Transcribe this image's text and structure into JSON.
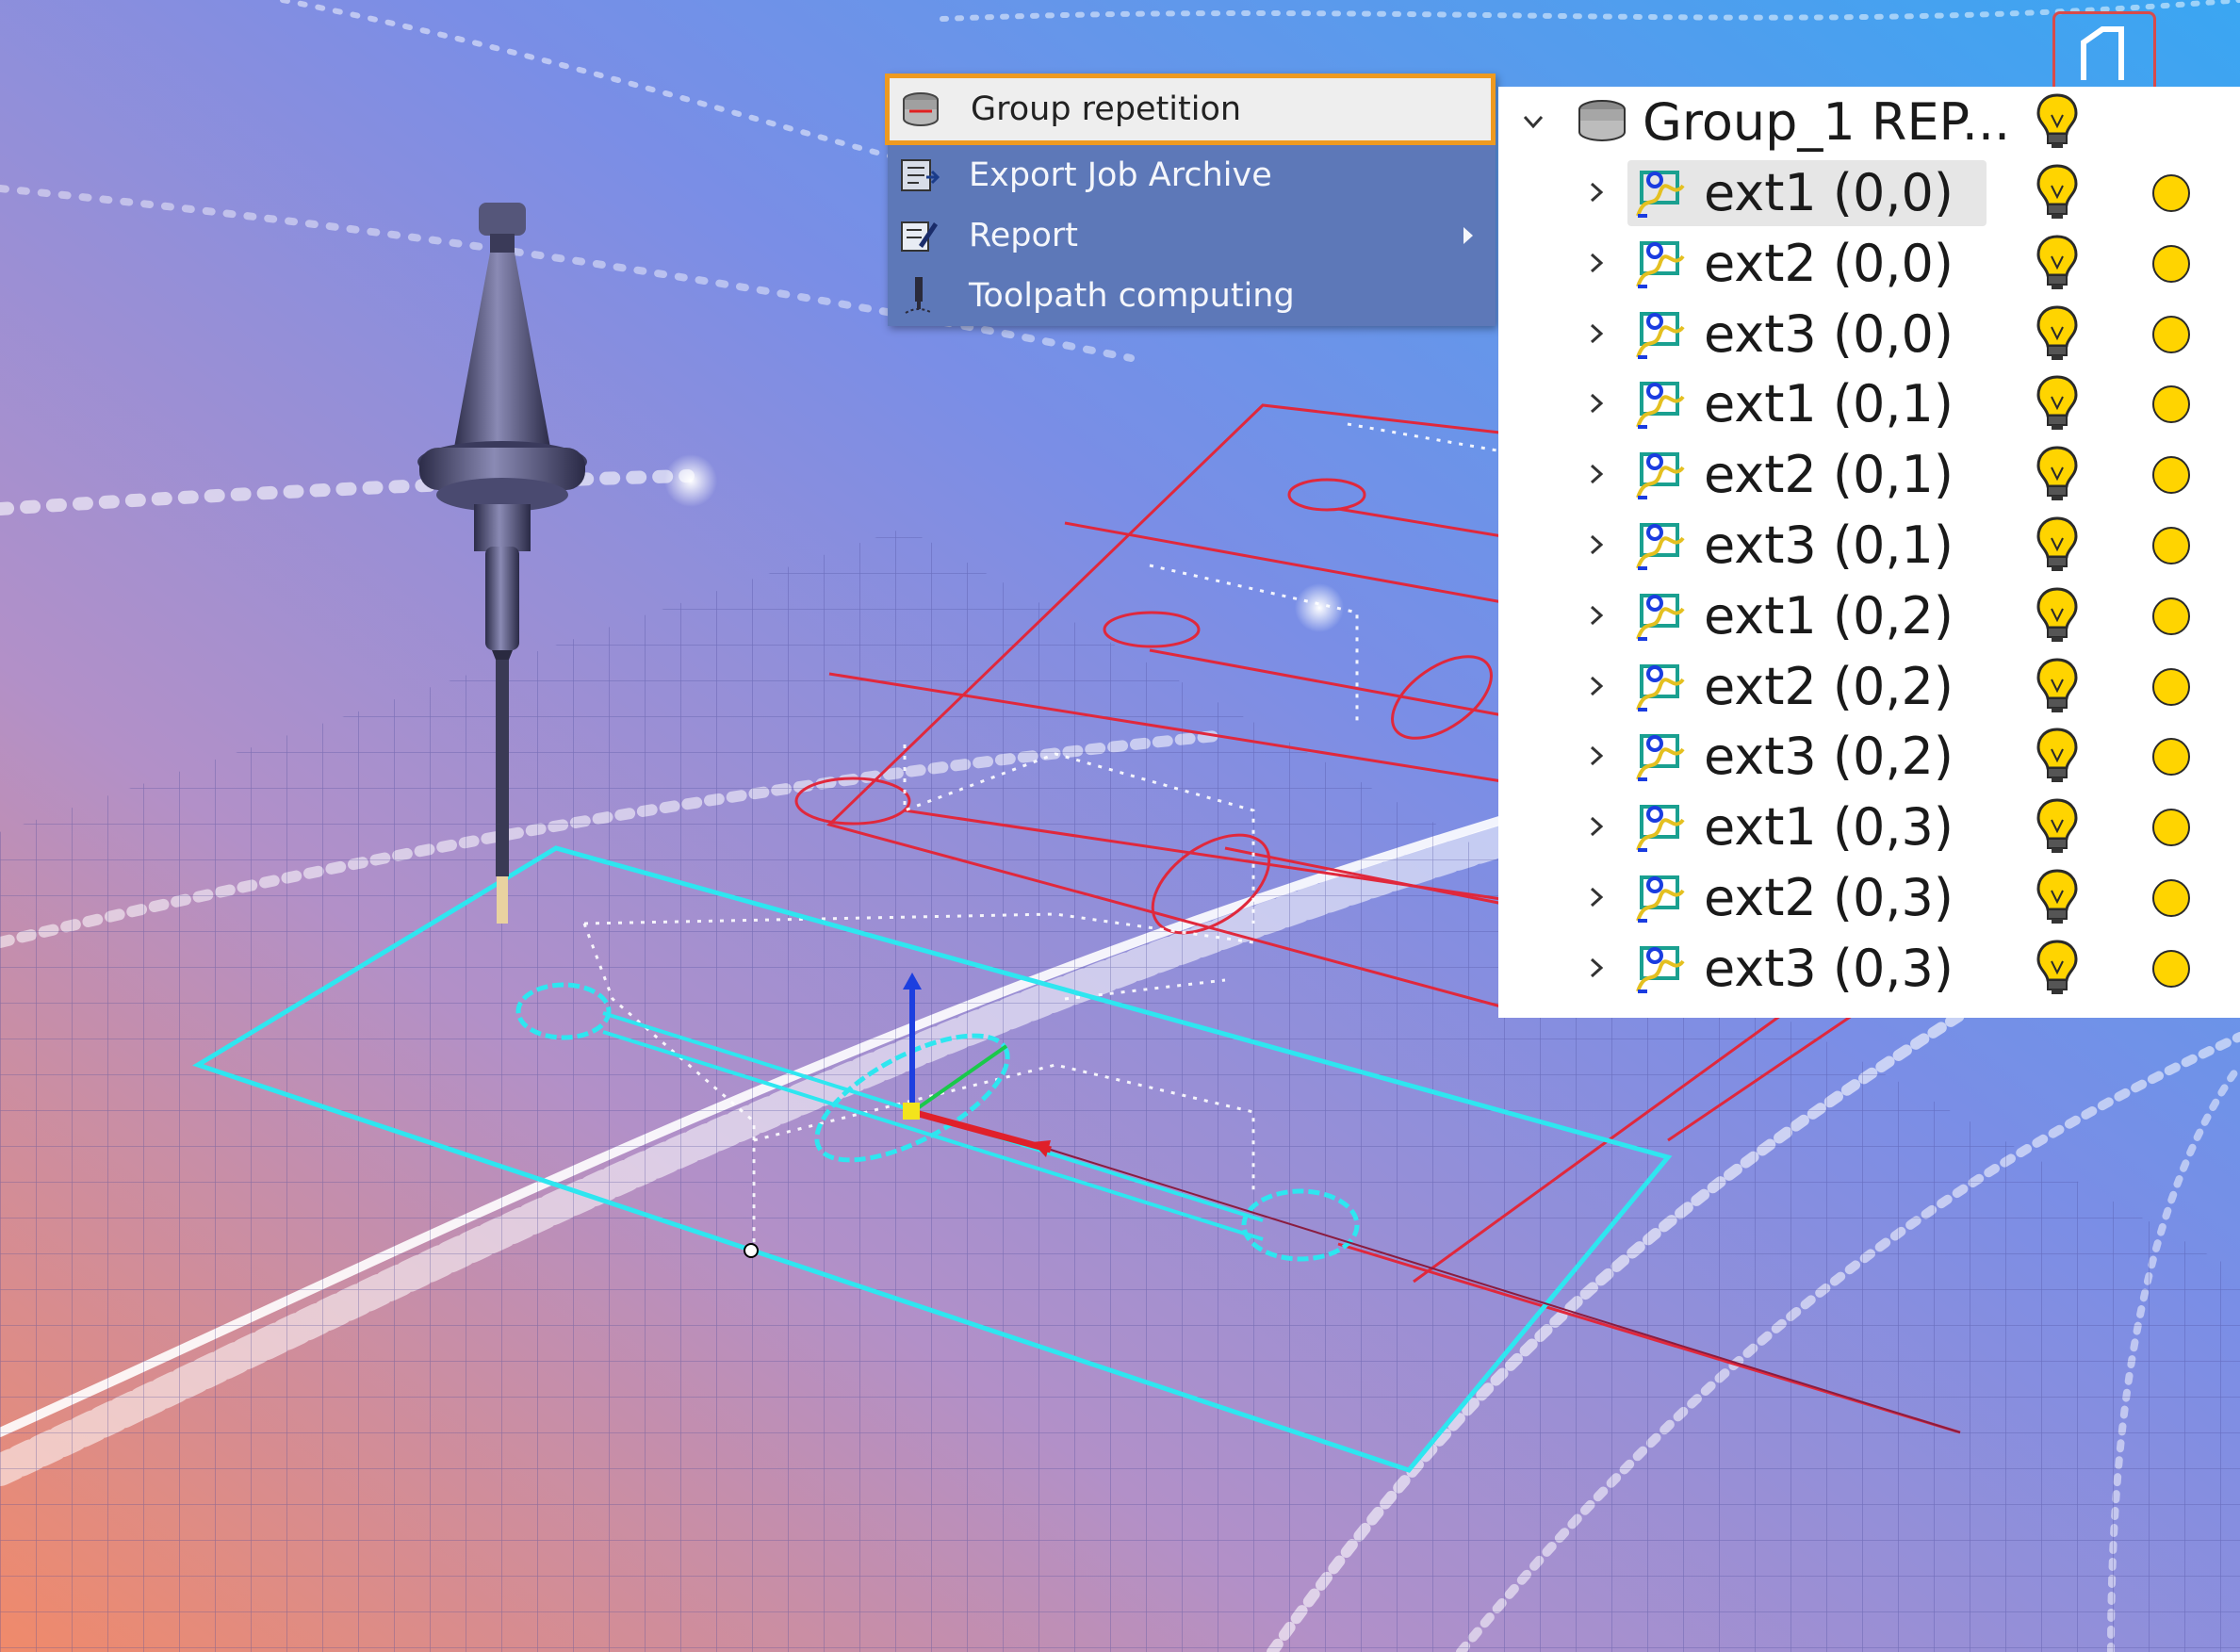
{
  "context_menu": {
    "items": [
      {
        "label": "Group repetition",
        "icon": "group-repetition-icon",
        "highlighted": true
      },
      {
        "label": "Export Job Archive",
        "icon": "export-archive-icon"
      },
      {
        "label": "Report",
        "icon": "report-icon",
        "has_submenu": true
      },
      {
        "label": "Toolpath computing",
        "icon": "toolpath-icon"
      }
    ],
    "highlight_color": "#ee9a20"
  },
  "tree": {
    "group": {
      "label": "Group_1 REP...",
      "icon": "group-stack-icon",
      "expanded": true
    },
    "children": [
      {
        "label": "ext1 (0,0)",
        "selected": true
      },
      {
        "label": "ext2 (0,0)"
      },
      {
        "label": "ext3 (0,0)"
      },
      {
        "label": "ext1 (0,1)"
      },
      {
        "label": "ext2 (0,1)"
      },
      {
        "label": "ext3 (0,1)"
      },
      {
        "label": "ext1 (0,2)"
      },
      {
        "label": "ext2 (0,2)"
      },
      {
        "label": "ext3 (0,2)"
      },
      {
        "label": "ext1 (0,3)"
      },
      {
        "label": "ext2 (0,3)"
      },
      {
        "label": "ext3 (0,3)"
      }
    ],
    "status_color": "#ffd400"
  },
  "colors": {
    "selected_outline": "#2ee6f0",
    "unselected_outline": "#e0283c",
    "axis_x": "#e0202a",
    "axis_y": "#19c94a",
    "axis_z": "#1c3fe0"
  }
}
